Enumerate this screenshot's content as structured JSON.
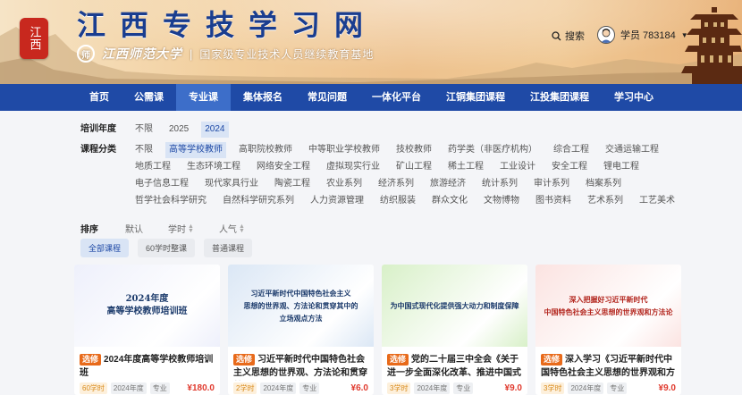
{
  "header": {
    "seal_text": "江西",
    "site_title": "江西专技学习网",
    "uni_logo_char": "师",
    "uni_name": "江西师范大学",
    "uni_slogan": "国家级专业技术人员继续教育基地",
    "search_label": "搜索",
    "user_label": "学员 783184"
  },
  "nav": [
    "首页",
    "公需课",
    "专业课",
    "集体报名",
    "常见问题",
    "一体化平台",
    "江铜集团课程",
    "江投集团课程",
    "学习中心"
  ],
  "filters": {
    "year_label": "培训年度",
    "years": [
      "不限",
      "2025",
      "2024"
    ],
    "cat_label": "课程分类",
    "categories": [
      "不限",
      "高等学校教师",
      "高职院校教师",
      "中等职业学校教师",
      "技校教师",
      "药学类（非医疗机构）",
      "综合工程",
      "交通运输工程",
      "地质工程",
      "生态环境工程",
      "网络安全工程",
      "虚拟现实行业",
      "矿山工程",
      "稀土工程",
      "工业设计",
      "安全工程",
      "锂电工程",
      "电子信息工程",
      "现代家具行业",
      "陶瓷工程",
      "农业系列",
      "经济系列",
      "旅游经济",
      "统计系列",
      "审计系列",
      "档案系列",
      "哲学社会科学研究",
      "自然科学研究系列",
      "人力资源管理",
      "纺织服装",
      "群众文化",
      "文物博物",
      "图书资料",
      "艺术系列",
      "工艺美术"
    ]
  },
  "sort": {
    "label": "排序",
    "options": [
      "默认",
      "学时",
      "人气"
    ]
  },
  "type_tabs": [
    "全部课程",
    "60学时整课",
    "普通课程"
  ],
  "cards": [
    {
      "thumb_lines": [
        "2024年度",
        "高等学校教师培训班"
      ],
      "badge": "选修",
      "title": "2024年度高等学校教师培训班",
      "hours": "60学时",
      "year": "2024年度",
      "type": "专业",
      "price": "¥180.0",
      "color": "#eef0fb"
    },
    {
      "thumb_lines": [
        "习近平新时代中国特色社会主义",
        "思想的世界观、方法论和贯穿其中的",
        "立场观点方法"
      ],
      "badge": "选修",
      "title": "习近平新时代中国特色社会主义思想的世界观、方法论和贯穿其...",
      "hours": "2学时",
      "year": "2024年度",
      "type": "专业",
      "price": "¥6.0",
      "color": "#dbe7f5"
    },
    {
      "thumb_lines": [
        "为中国式现代化提供强大动力和制度保障"
      ],
      "badge": "选修",
      "title": "党的二十届三中全会《关于进一步全面深化改革、推进中国式现...",
      "hours": "3学时",
      "year": "2024年度",
      "type": "专业",
      "price": "¥9.0",
      "color": "#d8f0c8"
    },
    {
      "thumb_lines": [
        "深入把握好习近平新时代",
        "中国特色社会主义思想的世界观和方法论"
      ],
      "badge": "选修",
      "title": "深入学习《习近平新时代中国特色社会主义思想的世界观和方法...",
      "hours": "3学时",
      "year": "2024年度",
      "type": "专业",
      "price": "¥9.0",
      "color": "#fbe3e1"
    }
  ]
}
